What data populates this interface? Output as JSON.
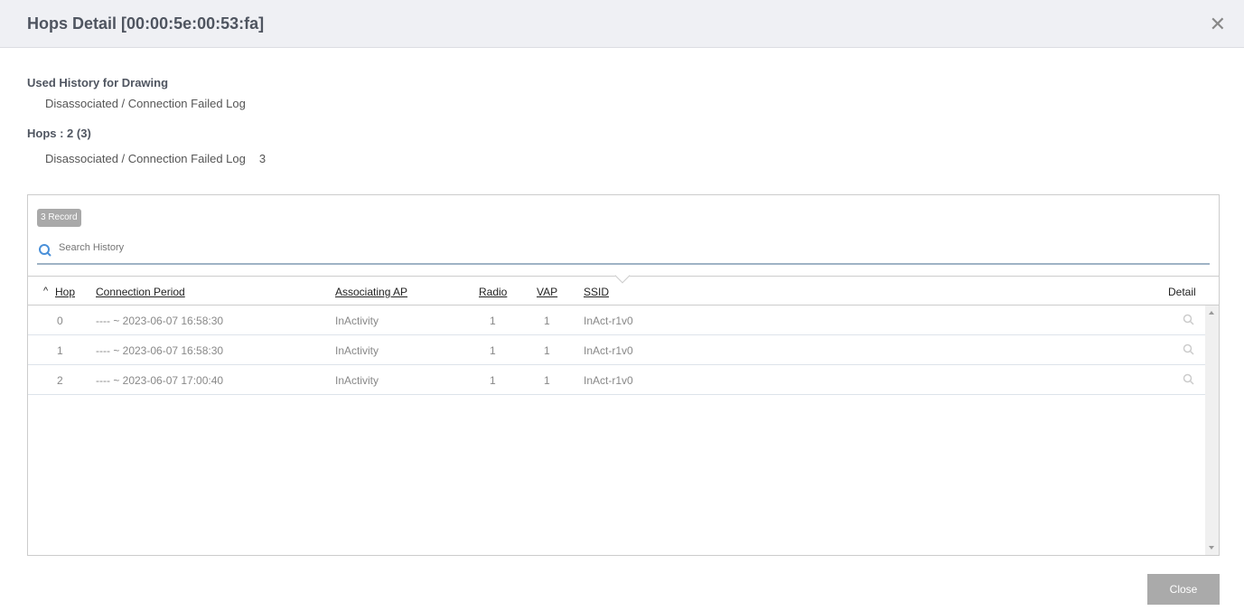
{
  "header": {
    "title": "Hops Detail",
    "mac": "[00:00:5e:00:53:fa]"
  },
  "used_history": {
    "label": "Used History for Drawing",
    "value": "Disassociated / Connection Failed Log"
  },
  "hops": {
    "label": "Hops : 2 (3)",
    "value": "Disassociated / Connection Failed Log",
    "count": "3"
  },
  "record_badge": "3 Record",
  "search": {
    "placeholder": "Search History",
    "value": ""
  },
  "columns": {
    "hop": "Hop",
    "period": "Connection Period",
    "ap": "Associating AP",
    "radio": "Radio",
    "vap": "VAP",
    "ssid": "SSID",
    "detail": "Detail"
  },
  "rows": [
    {
      "hop": "0",
      "period": "---- ~ 2023-06-07 16:58:30",
      "ap": "InActivity",
      "radio": "1",
      "vap": "1",
      "ssid": "InAct-r1v0"
    },
    {
      "hop": "1",
      "period": "---- ~ 2023-06-07 16:58:30",
      "ap": "InActivity",
      "radio": "1",
      "vap": "1",
      "ssid": "InAct-r1v0"
    },
    {
      "hop": "2",
      "period": "---- ~ 2023-06-07 17:00:40",
      "ap": "InActivity",
      "radio": "1",
      "vap": "1",
      "ssid": "InAct-r1v0"
    }
  ],
  "footer": {
    "close": "Close"
  }
}
